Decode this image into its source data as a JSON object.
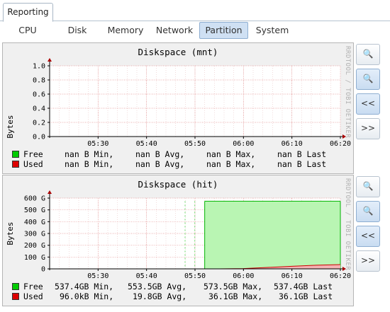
{
  "main_tab": "Reporting",
  "subtabs": [
    "CPU",
    "Disk",
    "Memory",
    "Network",
    "Partition",
    "System"
  ],
  "active_subtab": "Partition",
  "side_buttons": {
    "zoom_in": "+",
    "zoom_out": "−",
    "back": "<<",
    "forward": ">>"
  },
  "graphs": [
    {
      "title": "Diskspace (mnt)",
      "ylabel": "Bytes",
      "watermark": "RRDTOOL / TOBI OETIKER",
      "legend": [
        {
          "label": "Free",
          "color": "#00cc00",
          "min": "nan B Min,",
          "avg": "nan B Avg,",
          "max": "nan B Max,",
          "last": "nan B Last"
        },
        {
          "label": "Used",
          "color": "#dd0000",
          "min": "nan B Min,",
          "avg": "nan B Avg,",
          "max": "nan B Max,",
          "last": "nan B Last"
        }
      ]
    },
    {
      "title": "Diskspace (hit)",
      "ylabel": "Bytes",
      "watermark": "RRDTOOL / TOBI OETIKER",
      "legend": [
        {
          "label": "Free",
          "color": "#00cc00",
          "min": "537.4GB Min,",
          "avg": "553.5GB Avg,",
          "max": "573.5GB Max,",
          "last": "537.4GB Last"
        },
        {
          "label": "Used",
          "color": "#dd0000",
          "min": "96.0kB Min,",
          "avg": "19.8GB Avg,",
          "max": "36.1GB Max,",
          "last": "36.1GB Last"
        }
      ]
    }
  ],
  "chart_data": [
    {
      "type": "area",
      "title": "Diskspace (mnt)",
      "ylabel": "Bytes",
      "x_ticks": [
        "05:30",
        "05:40",
        "05:50",
        "06:00",
        "06:10",
        "06:20"
      ],
      "y_ticks": [
        "0.0",
        "0.2",
        "0.4",
        "0.6",
        "0.8",
        "1.0"
      ],
      "ylim": [
        0,
        1.0
      ],
      "series": [
        {
          "name": "Free",
          "values": []
        },
        {
          "name": "Used",
          "values": []
        }
      ]
    },
    {
      "type": "area",
      "title": "Diskspace (hit)",
      "ylabel": "Bytes",
      "x_ticks": [
        "05:30",
        "05:40",
        "05:50",
        "06:00",
        "06:10",
        "06:20"
      ],
      "y_ticks": [
        "0",
        "100 G",
        "200 G",
        "300 G",
        "400 G",
        "500 G",
        "600 G"
      ],
      "ylim": [
        0,
        600
      ],
      "series": [
        {
          "name": "Free",
          "x": [
            "05:52",
            "05:55",
            "06:00",
            "06:05",
            "06:10",
            "06:15",
            "06:20"
          ],
          "values": [
            573.5,
            573.5,
            573.5,
            573.5,
            573.5,
            573.5,
            573.5
          ]
        },
        {
          "name": "Used",
          "x": [
            "05:52",
            "05:55",
            "06:00",
            "06:05",
            "06:10",
            "06:15",
            "06:20"
          ],
          "values": [
            0,
            0,
            2,
            12,
            22,
            31,
            36.1
          ]
        }
      ]
    }
  ]
}
